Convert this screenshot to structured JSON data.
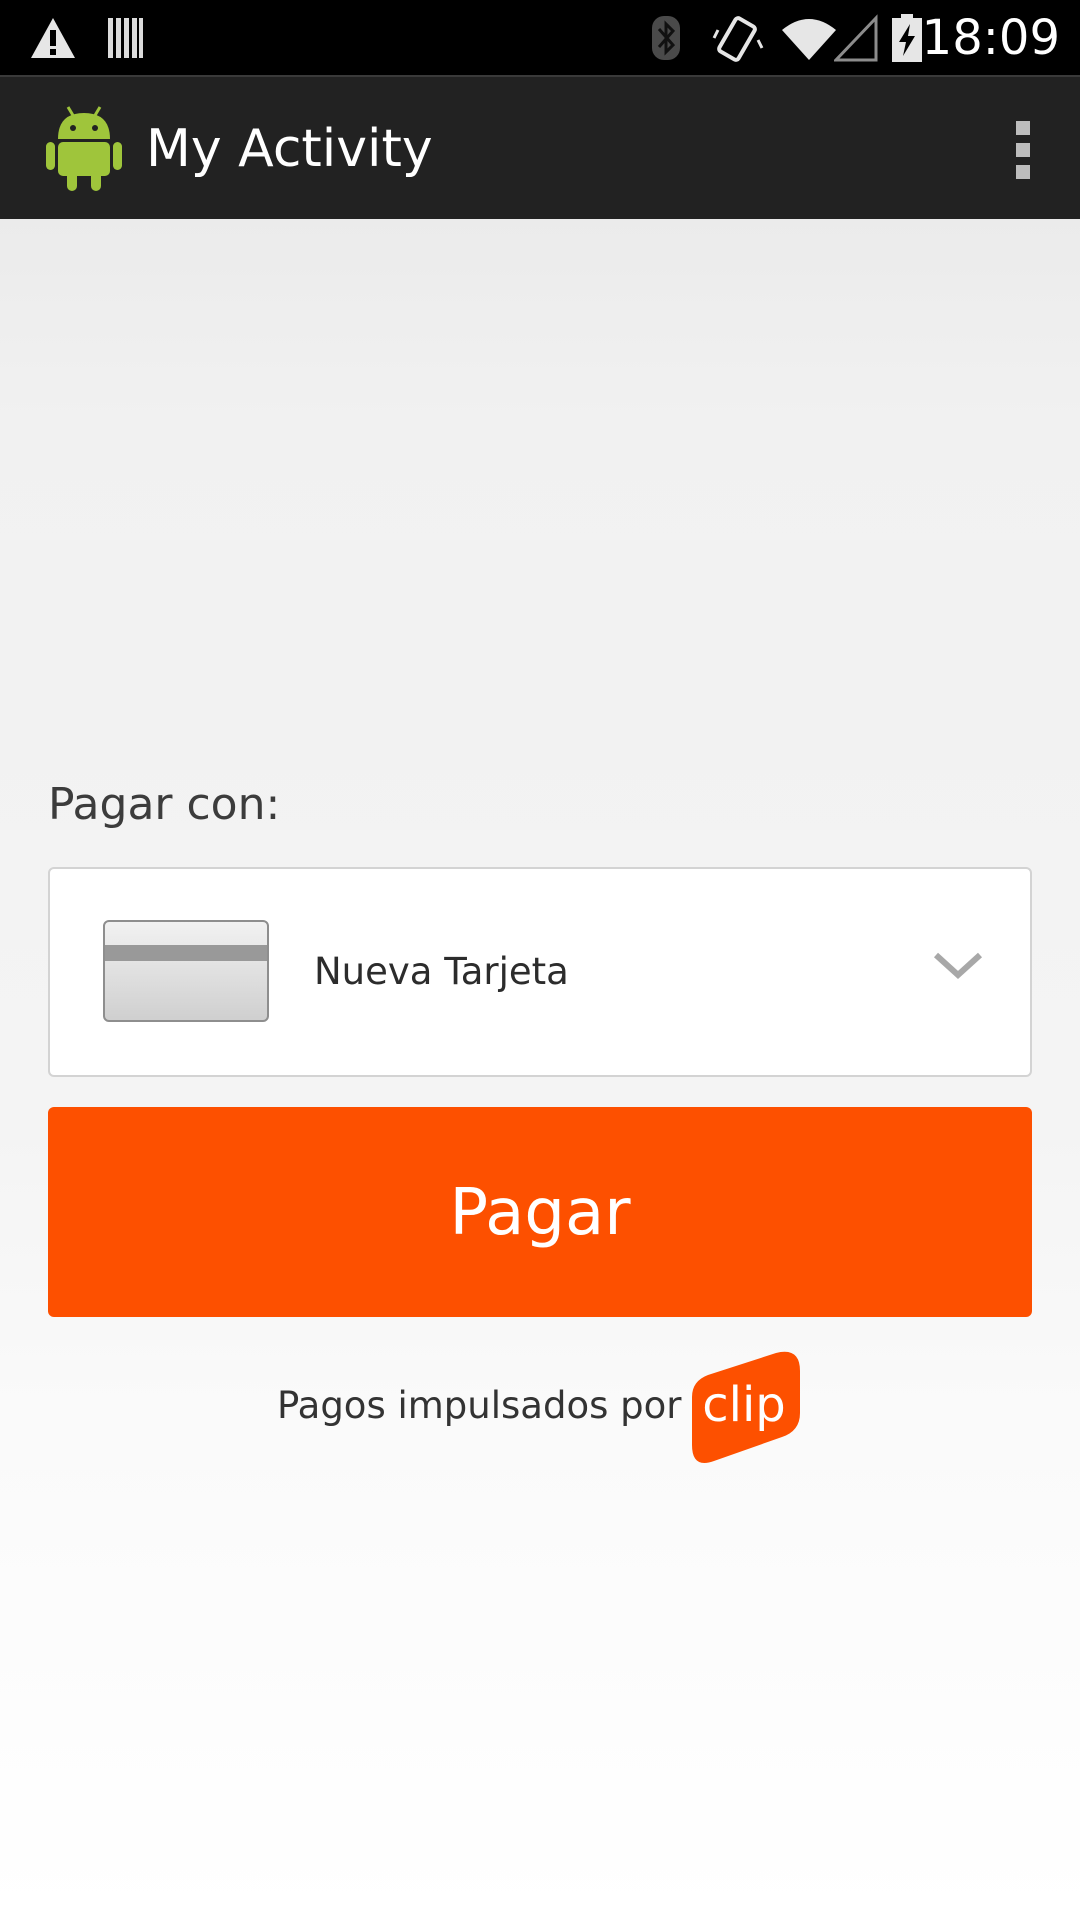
{
  "status_bar": {
    "time": "18:09",
    "icons": [
      "warning-icon",
      "barcode-icon",
      "bluetooth-icon",
      "vibrate-icon",
      "wifi-icon",
      "cell-signal-icon",
      "battery-charging-icon"
    ]
  },
  "action_bar": {
    "title": "My Activity",
    "logo": "android-robot-icon",
    "menu_icon": "overflow-menu-icon"
  },
  "payment": {
    "label": "Pagar con:",
    "selected_card": "Nueva Tarjeta",
    "card_icon": "credit-card-icon",
    "dropdown_icon": "chevron-down-icon",
    "pay_button": "Pagar",
    "powered_by": "Pagos impulsados por",
    "brand_logo_text": "clip"
  },
  "colors": {
    "accent": "#fd5000",
    "action_bar": "#222222",
    "status_bar": "#000000"
  }
}
